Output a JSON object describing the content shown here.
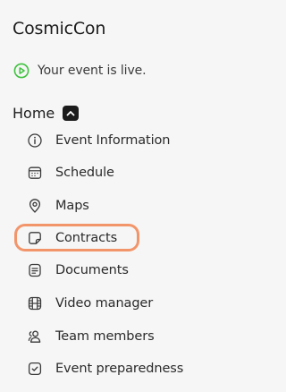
{
  "app": {
    "title": "CosmicCon"
  },
  "status": {
    "text": "Your event is live.",
    "icon": "play-circle-icon",
    "color": "#3fc23f"
  },
  "section": {
    "title": "Home",
    "toggle_icon": "chevron-up-icon"
  },
  "nav": {
    "items": [
      {
        "label": "Event Information",
        "icon": "info-icon"
      },
      {
        "label": "Schedule",
        "icon": "calendar-icon"
      },
      {
        "label": "Maps",
        "icon": "map-pin-icon"
      },
      {
        "label": "Contracts",
        "icon": "sticky-note-icon",
        "highlighted": true
      },
      {
        "label": "Documents",
        "icon": "document-icon"
      },
      {
        "label": "Video manager",
        "icon": "film-icon"
      },
      {
        "label": "Team members",
        "icon": "users-icon"
      },
      {
        "label": "Event preparedness",
        "icon": "check-badge-icon"
      }
    ]
  },
  "colors": {
    "highlight": "#f2956b",
    "background": "#f6f6f6",
    "text": "#1f1f1f"
  }
}
